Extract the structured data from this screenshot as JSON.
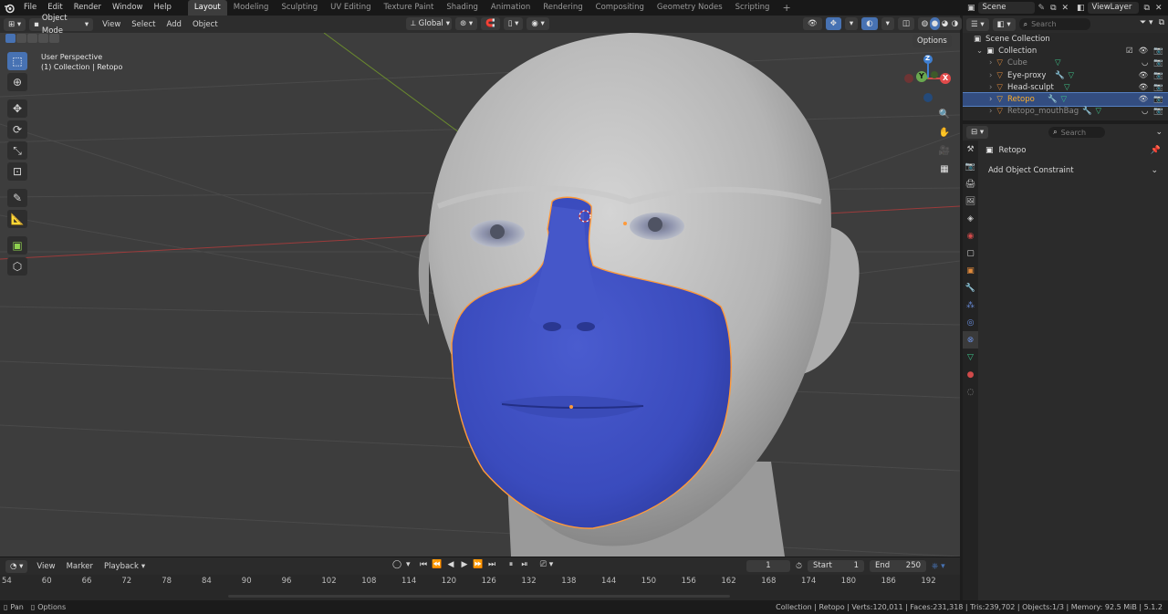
{
  "menu": {
    "items": [
      "File",
      "Edit",
      "Render",
      "Window",
      "Help"
    ],
    "workspaces": [
      "Layout",
      "Modeling",
      "Sculpting",
      "UV Editing",
      "Texture Paint",
      "Shading",
      "Animation",
      "Rendering",
      "Compositing",
      "Geometry Nodes",
      "Scripting"
    ],
    "active_workspace": "Layout",
    "add_workspace": "+",
    "scene": "Scene",
    "view_layer": "ViewLayer"
  },
  "viewport_header": {
    "mode": "Object Mode",
    "menus": [
      "View",
      "Select",
      "Add",
      "Object"
    ],
    "transform_orientation": "Global",
    "options": "Options"
  },
  "viewport": {
    "perspective_label": "User Perspective",
    "collection_label": "(1) Collection | Retopo",
    "gizmo_axes": {
      "x": "X",
      "y": "Y",
      "z": "Z"
    }
  },
  "outliner": {
    "search_placeholder": "Search",
    "scene_collection": "Scene Collection",
    "collection": "Collection",
    "objects": [
      {
        "name": "Cube",
        "style": "dim"
      },
      {
        "name": "Eye-proxy",
        "style": "normal"
      },
      {
        "name": "Head-sculpt",
        "style": "normal"
      },
      {
        "name": "Retopo",
        "style": "orange"
      },
      {
        "name": "Retopo_mouthBag",
        "style": "dim"
      }
    ]
  },
  "properties": {
    "search_placeholder": "Search",
    "object_name": "Retopo",
    "add_constraint": "Add Object Constraint"
  },
  "timeline": {
    "menus": [
      "View",
      "Marker",
      "Playback"
    ],
    "current_frame": "1",
    "start_label": "Start",
    "start_value": "1",
    "end_label": "End",
    "end_value": "250",
    "frame_labels": [
      "54",
      "60",
      "66",
      "72",
      "78",
      "84",
      "90",
      "96",
      "102",
      "108",
      "114",
      "120",
      "126",
      "132",
      "138",
      "144",
      "150",
      "156",
      "162",
      "168",
      "174",
      "180",
      "186",
      "192"
    ]
  },
  "statusbar": {
    "left_pan": "Pan",
    "left_options": "Options",
    "stats": "Collection | Retopo | Verts:120,011 | Faces:231,318 | Tris:239,702 | Objects:1/3 | Memory: 92.5 MiB | 5.1.2"
  },
  "colors": {
    "accent": "#4772b3",
    "mesh_blue": "#3e4fc2",
    "selected_orange": "#ffaf29",
    "viewport_bg": "#3d3d3d"
  }
}
